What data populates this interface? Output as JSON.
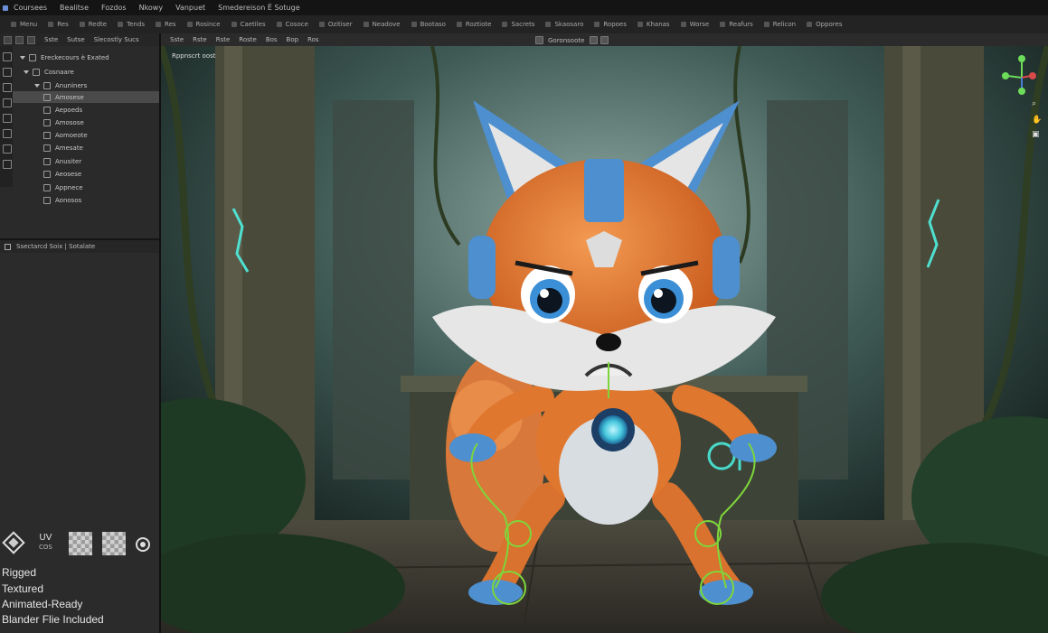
{
  "titlebar": {
    "items": [
      "Coursees",
      "Bealitse",
      "Fozdos",
      "Nkowy",
      "Vanpuet",
      "Smedereison Ë Sotuge"
    ]
  },
  "menubar": {
    "items": [
      "Menu",
      "Res",
      "Redte",
      "Tends",
      "Res",
      "Rosince",
      "Caetiles",
      "Cosoce",
      "Ozitiser",
      "Neadove",
      "Bootaso",
      "Roztiote",
      "Sacrets",
      "Skaosaro",
      "Ropoes",
      "Khanas",
      "Worse",
      "Reafurs",
      "Relicon",
      "Oppores"
    ]
  },
  "toolbar_left": {
    "items": [
      "Sste",
      "Sutse",
      "Slecostly Sucs"
    ]
  },
  "outliner": {
    "rows": [
      {
        "label": "Ereckecours è Exated",
        "sel": false
      },
      {
        "label": "Cosnaare",
        "sel": false
      },
      {
        "label": "Anuniners",
        "sel": false
      },
      {
        "label": "Amosese",
        "sel": true
      },
      {
        "label": "Aepoeds",
        "sel": false
      },
      {
        "label": "Amosose",
        "sel": false
      },
      {
        "label": "Aomoeote",
        "sel": false
      },
      {
        "label": "Amesate",
        "sel": false
      },
      {
        "label": "Anusiter",
        "sel": false
      },
      {
        "label": "Aeosese",
        "sel": false
      },
      {
        "label": "Appnece",
        "sel": false
      },
      {
        "label": "Aonosos",
        "sel": false
      }
    ]
  },
  "props_head": {
    "label": "Ssectarcd Soix | Sotalate"
  },
  "viewport": {
    "head_items": [
      "Sste",
      "Rste",
      "Rste",
      "Roste",
      "Bos",
      "Bop",
      "Ros"
    ],
    "center_label": "Goronsoote",
    "corner_label": "Rppnscrt oost"
  },
  "badges": {
    "uv": "UV",
    "uv_sub": "COS",
    "items": [
      "Rigged",
      "Textured",
      "Animated-Ready",
      "Blander Flie Included"
    ]
  },
  "colors": {
    "accent": "#4e8fcf",
    "fox_orange": "#e0772e",
    "rig_green": "#7ed63b"
  }
}
